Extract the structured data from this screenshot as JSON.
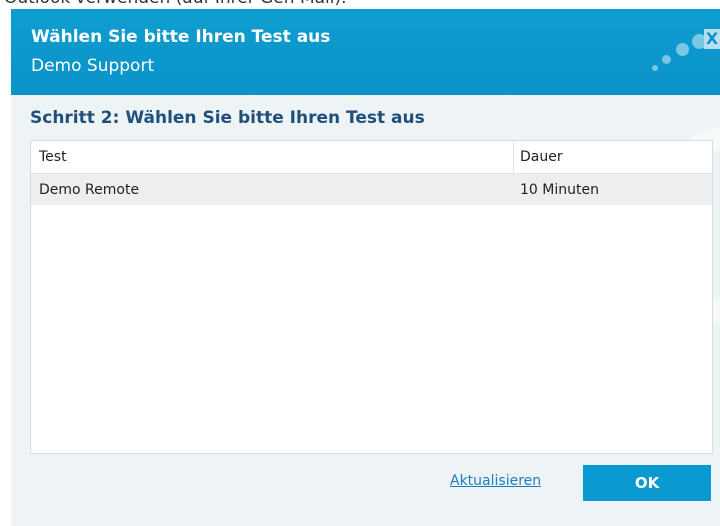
{
  "background_text": "Outlook verwenden (auf Ihrer Gen Mail).",
  "dialog": {
    "title": "Wählen Sie bitte Ihren Test aus",
    "subtitle": "Demo  Support",
    "close_label": "X"
  },
  "content": {
    "heading": "Schritt 2: Wählen Sie bitte Ihren Test aus",
    "table": {
      "columns": [
        "Test",
        "Dauer"
      ],
      "rows": [
        {
          "test": "Demo Remote",
          "duration": "10 Minuten"
        }
      ]
    }
  },
  "footer": {
    "refresh_label": "Aktualisieren",
    "ok_label": "OK"
  },
  "colors": {
    "header_blue": "#0a93c8",
    "heading_text": "#1f4f7a",
    "link": "#1a7fc2",
    "button": "#0a99d0"
  }
}
